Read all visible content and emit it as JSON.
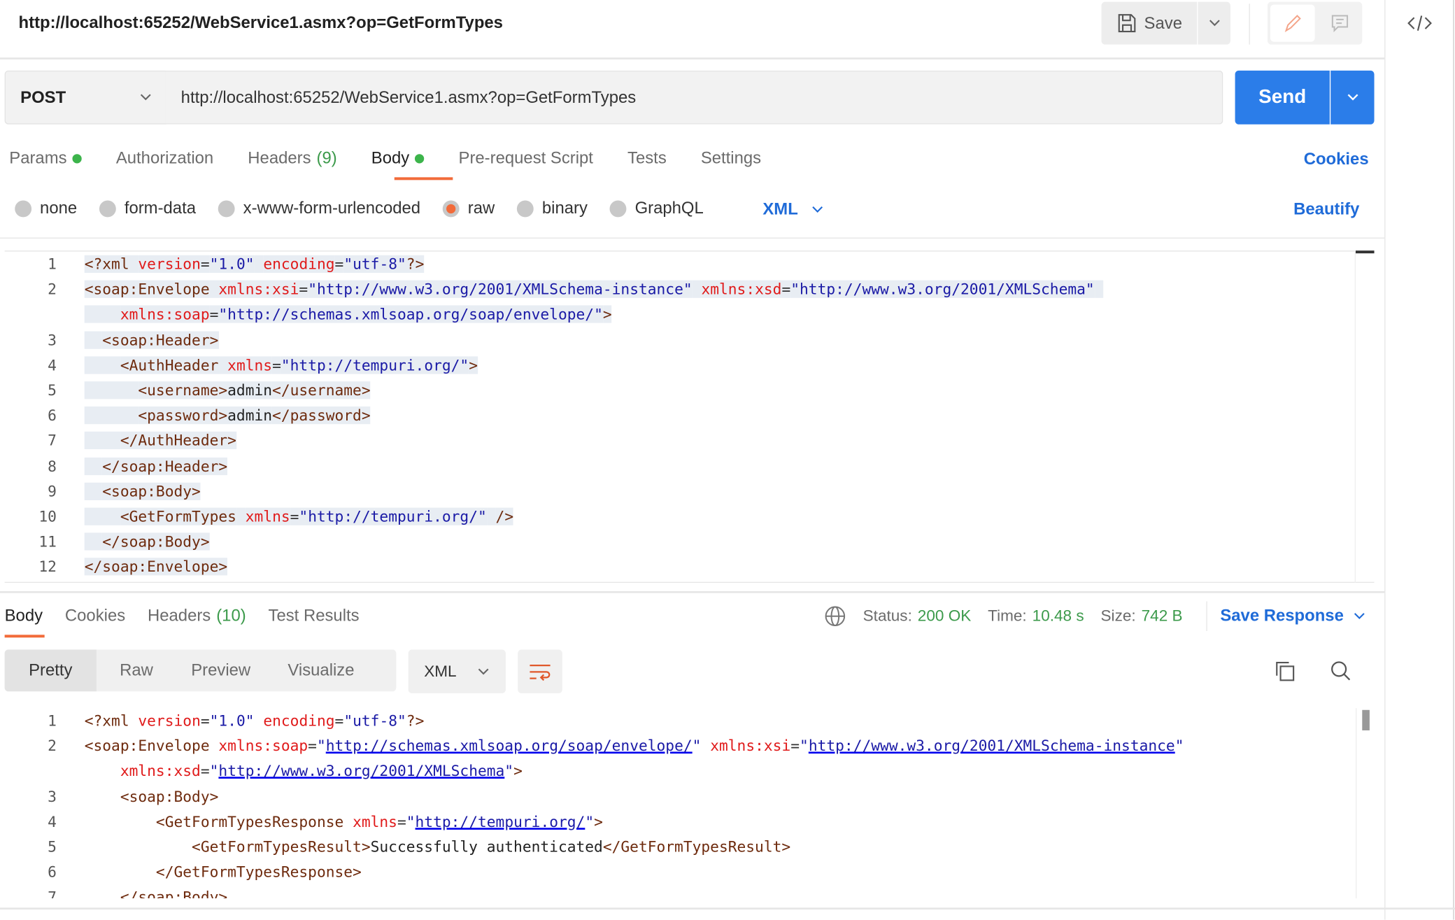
{
  "header": {
    "title": "http://localhost:65252/WebService1.asmx?op=GetFormTypes",
    "save_label": "Save"
  },
  "request": {
    "method": "POST",
    "url": "http://localhost:65252/WebService1.asmx?op=GetFormTypes",
    "send_label": "Send"
  },
  "request_tabs": [
    {
      "label": "Params",
      "dot": true
    },
    {
      "label": "Authorization"
    },
    {
      "label": "Headers",
      "count": "(9)"
    },
    {
      "label": "Body",
      "dot": true,
      "active": true
    },
    {
      "label": "Pre-request Script"
    },
    {
      "label": "Tests"
    },
    {
      "label": "Settings"
    }
  ],
  "cookies_label": "Cookies",
  "body_types": [
    {
      "label": "none"
    },
    {
      "label": "form-data"
    },
    {
      "label": "x-www-form-urlencoded"
    },
    {
      "label": "raw",
      "selected": true
    },
    {
      "label": "binary"
    },
    {
      "label": "GraphQL"
    }
  ],
  "body_format": "XML",
  "beautify_label": "Beautify",
  "colors": {
    "accent": "#f26b3a",
    "send": "#2b7de9",
    "link": "#1f6bd8",
    "success": "#3c9a4b"
  },
  "request_body": [
    {
      "n": "1",
      "t": [
        [
          "tag",
          "<?xml"
        ],
        [
          "sp",
          " "
        ],
        [
          "attr",
          "version"
        ],
        [
          "eq",
          "="
        ],
        [
          "val",
          "\"1.0\""
        ],
        [
          "sp",
          " "
        ],
        [
          "attr",
          "encoding"
        ],
        [
          "eq",
          "="
        ],
        [
          "val",
          "\"utf-8\""
        ],
        [
          "tag",
          "?>"
        ]
      ]
    },
    {
      "n": "2",
      "t": [
        [
          "tag",
          "<soap:Envelope"
        ],
        [
          "sp",
          " "
        ],
        [
          "attr",
          "xmlns:xsi"
        ],
        [
          "eq",
          "="
        ],
        [
          "val",
          "\"http://www.w3.org/2001/XMLSchema-instance\""
        ],
        [
          "sp",
          " "
        ],
        [
          "attr",
          "xmlns:xsd"
        ],
        [
          "eq",
          "="
        ],
        [
          "val",
          "\"http://www.w3.org/2001/XMLSchema\""
        ],
        [
          "sp",
          " "
        ]
      ]
    },
    {
      "n": "",
      "t": [
        [
          "sp",
          "    "
        ],
        [
          "attr",
          "xmlns:soap"
        ],
        [
          "eq",
          "="
        ],
        [
          "val",
          "\"http://schemas.xmlsoap.org/soap/envelope/\""
        ],
        [
          "tag",
          ">"
        ]
      ]
    },
    {
      "n": "3",
      "t": [
        [
          "sp",
          "  "
        ],
        [
          "tag",
          "<soap:Header>"
        ]
      ]
    },
    {
      "n": "4",
      "t": [
        [
          "sp",
          "    "
        ],
        [
          "tag",
          "<AuthHeader"
        ],
        [
          "sp",
          " "
        ],
        [
          "attr",
          "xmlns"
        ],
        [
          "eq",
          "="
        ],
        [
          "val",
          "\"http://tempuri.org/\""
        ],
        [
          "tag",
          ">"
        ]
      ]
    },
    {
      "n": "5",
      "t": [
        [
          "sp",
          "      "
        ],
        [
          "tag",
          "<username>"
        ],
        [
          "text",
          "admin"
        ],
        [
          "tag",
          "</username>"
        ]
      ]
    },
    {
      "n": "6",
      "t": [
        [
          "sp",
          "      "
        ],
        [
          "tag",
          "<password>"
        ],
        [
          "text",
          "admin"
        ],
        [
          "tag",
          "</password>"
        ]
      ]
    },
    {
      "n": "7",
      "t": [
        [
          "sp",
          "    "
        ],
        [
          "tag",
          "</AuthHeader>"
        ]
      ]
    },
    {
      "n": "8",
      "t": [
        [
          "sp",
          "  "
        ],
        [
          "tag",
          "</soap:Header>"
        ]
      ]
    },
    {
      "n": "9",
      "t": [
        [
          "sp",
          "  "
        ],
        [
          "tag",
          "<soap:Body>"
        ]
      ]
    },
    {
      "n": "10",
      "t": [
        [
          "sp",
          "    "
        ],
        [
          "tag",
          "<GetFormTypes"
        ],
        [
          "sp",
          " "
        ],
        [
          "attr",
          "xmlns"
        ],
        [
          "eq",
          "="
        ],
        [
          "val",
          "\"http://tempuri.org/\""
        ],
        [
          "sp",
          " "
        ],
        [
          "tag",
          "/>"
        ]
      ]
    },
    {
      "n": "11",
      "t": [
        [
          "sp",
          "  "
        ],
        [
          "tag",
          "</soap:Body>"
        ]
      ]
    },
    {
      "n": "12",
      "t": [
        [
          "tag",
          "</soap:Envelope>"
        ]
      ]
    }
  ],
  "response_tabs": [
    {
      "label": "Body",
      "active": true
    },
    {
      "label": "Cookies"
    },
    {
      "label": "Headers",
      "count": "(10)"
    },
    {
      "label": "Test Results"
    }
  ],
  "status": {
    "status_label": "Status:",
    "status_value": "200 OK",
    "time_label": "Time:",
    "time_value": "10.48 s",
    "size_label": "Size:",
    "size_value": "742 B"
  },
  "save_response_label": "Save Response",
  "view_modes": [
    {
      "label": "Pretty",
      "active": true
    },
    {
      "label": "Raw"
    },
    {
      "label": "Preview"
    },
    {
      "label": "Visualize"
    }
  ],
  "response_format": "XML",
  "response_body": [
    {
      "n": "1",
      "t": [
        [
          "tag",
          "<?xml"
        ],
        [
          "sp",
          " "
        ],
        [
          "attr",
          "version"
        ],
        [
          "eq",
          "="
        ],
        [
          "val",
          "\"1.0\""
        ],
        [
          "sp",
          " "
        ],
        [
          "attr",
          "encoding"
        ],
        [
          "eq",
          "="
        ],
        [
          "val",
          "\"utf-8\""
        ],
        [
          "tag",
          "?>"
        ]
      ]
    },
    {
      "n": "2",
      "t": [
        [
          "tag",
          "<soap:Envelope"
        ],
        [
          "sp",
          " "
        ],
        [
          "attr",
          "xmlns:soap"
        ],
        [
          "eq",
          "="
        ],
        [
          "val",
          "\""
        ],
        [
          "link",
          "http://schemas.xmlsoap.org/soap/envelope/"
        ],
        [
          "val",
          "\""
        ],
        [
          "sp",
          " "
        ],
        [
          "attr",
          "xmlns:xsi"
        ],
        [
          "eq",
          "="
        ],
        [
          "val",
          "\""
        ],
        [
          "link",
          "http://www.w3.org/2001/XMLSchema-instance"
        ],
        [
          "val",
          "\""
        ]
      ]
    },
    {
      "n": "",
      "t": [
        [
          "sp",
          "    "
        ],
        [
          "attr",
          "xmlns:xsd"
        ],
        [
          "eq",
          "="
        ],
        [
          "val",
          "\""
        ],
        [
          "link",
          "http://www.w3.org/2001/XMLSchema"
        ],
        [
          "val",
          "\""
        ],
        [
          "tag",
          ">"
        ]
      ]
    },
    {
      "n": "3",
      "t": [
        [
          "sp",
          "    "
        ],
        [
          "tag",
          "<soap:Body>"
        ]
      ]
    },
    {
      "n": "4",
      "t": [
        [
          "sp",
          "        "
        ],
        [
          "tag",
          "<GetFormTypesResponse"
        ],
        [
          "sp",
          " "
        ],
        [
          "attr",
          "xmlns"
        ],
        [
          "eq",
          "="
        ],
        [
          "val",
          "\""
        ],
        [
          "link",
          "http://tempuri.org/"
        ],
        [
          "val",
          "\""
        ],
        [
          "tag",
          ">"
        ]
      ]
    },
    {
      "n": "5",
      "t": [
        [
          "sp",
          "            "
        ],
        [
          "tag",
          "<GetFormTypesResult>"
        ],
        [
          "text",
          "Successfully authenticated"
        ],
        [
          "tag",
          "</GetFormTypesResult>"
        ]
      ]
    },
    {
      "n": "6",
      "t": [
        [
          "sp",
          "        "
        ],
        [
          "tag",
          "</GetFormTypesResponse>"
        ]
      ]
    },
    {
      "n": "7",
      "t": [
        [
          "sp",
          "    "
        ],
        [
          "tag",
          "</soap:Body>"
        ]
      ]
    }
  ]
}
